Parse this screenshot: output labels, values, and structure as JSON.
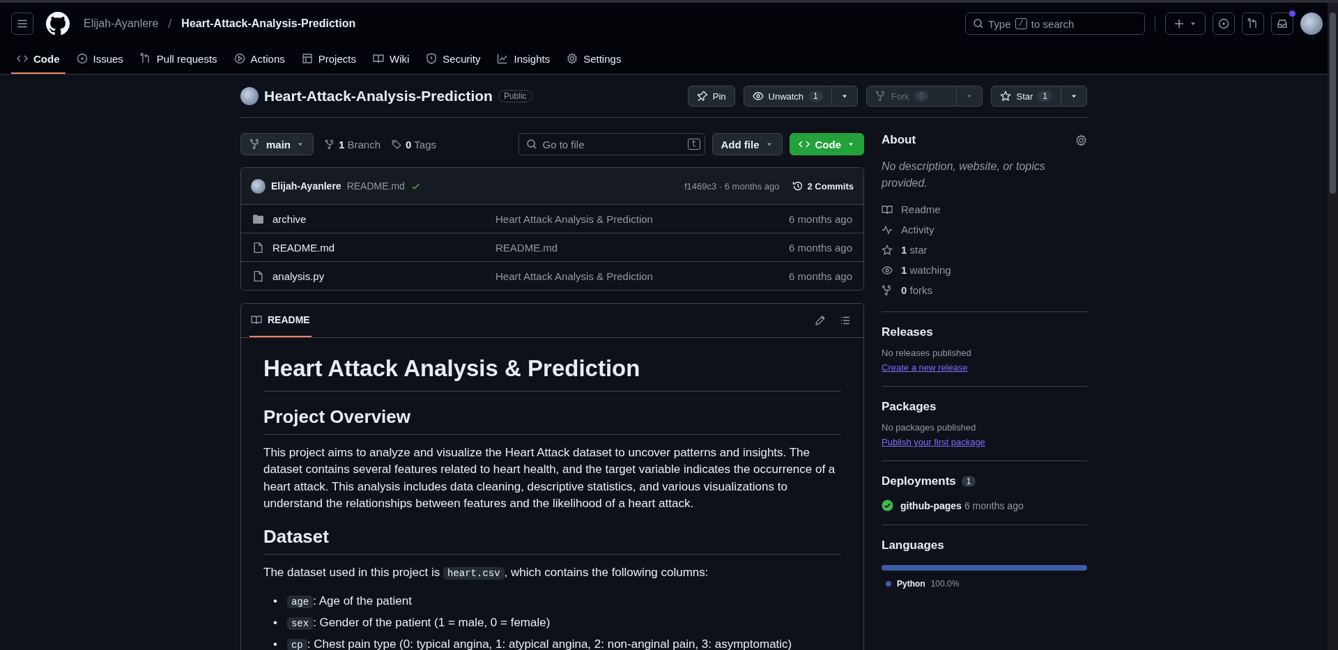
{
  "header": {
    "owner": "Elijah-Ayanlere",
    "separator": "/",
    "repo": "Heart-Attack-Analysis-Prediction",
    "search": {
      "before": "Type",
      "key": "/",
      "after": "to search"
    },
    "unread_notifications": true
  },
  "nav_tabs": [
    {
      "label": "Code",
      "selected": true
    },
    {
      "label": "Issues",
      "selected": false
    },
    {
      "label": "Pull requests",
      "selected": false
    },
    {
      "label": "Actions",
      "selected": false
    },
    {
      "label": "Projects",
      "selected": false
    },
    {
      "label": "Wiki",
      "selected": false
    },
    {
      "label": "Security",
      "selected": false
    },
    {
      "label": "Insights",
      "selected": false
    },
    {
      "label": "Settings",
      "selected": false
    }
  ],
  "repo": {
    "name": "Heart-Attack-Analysis-Prediction",
    "visibility": "Public",
    "actions": [
      {
        "label": "Pin",
        "disabled": false
      },
      {
        "label": "Unwatch",
        "count": "1",
        "disabled": false
      },
      {
        "label": "Fork",
        "count": "0",
        "disabled": true
      },
      {
        "label": "Star",
        "count": "1",
        "disabled": false
      }
    ]
  },
  "toolbar": {
    "branch": "main",
    "branches": "**1** Branch",
    "tags": "**0** Tags",
    "file_search": {
      "placeholder": "Go to file",
      "shortcut": "t"
    },
    "add_file": "Add file",
    "code_button": "Code"
  },
  "commit": {
    "author": "Elijah-Ayanlere",
    "message": "README.md",
    "passed": true,
    "hash_time": "f1469c3 · 6 months ago",
    "commits": "2 Commits"
  },
  "files": [
    {
      "kind": "folder",
      "name": "archive",
      "message": "Heart Attack Analysis & Prediction",
      "time": "6 months ago"
    },
    {
      "kind": "file",
      "name": "README.md",
      "message": "README.md",
      "time": "6 months ago"
    },
    {
      "kind": "file",
      "name": "analysis.py",
      "message": "Heart Attack Analysis & Prediction",
      "time": "6 months ago"
    }
  ],
  "readme": {
    "tab": "README",
    "blocks": [
      {
        "kind": "h1",
        "text": "Heart Attack Analysis & Prediction"
      },
      {
        "kind": "h2",
        "text": "Project Overview"
      },
      {
        "kind": "p",
        "parts": [
          {
            "text": "This project aims to analyze and visualize the Heart Attack dataset to uncover patterns and insights. The dataset contains several features related to heart health, and the target variable indicates the occurrence of a heart attack. This analysis includes data cleaning, descriptive statistics, and various visualizations to understand the relationships between features and the likelihood of a heart attack."
          }
        ]
      },
      {
        "kind": "h2",
        "text": "Dataset"
      },
      {
        "kind": "p",
        "parts": [
          {
            "text": "The dataset used in this project is "
          },
          {
            "code": "heart.csv"
          },
          {
            "text": ", which contains the following columns:"
          }
        ]
      },
      {
        "kind": "list",
        "marker": "•",
        "items": [
          {
            "code": "age",
            "text": ": Age of the patient"
          },
          {
            "code": "sex",
            "text": ": Gender of the patient (1 = male, 0 = female)"
          },
          {
            "code": "cp",
            "text": ": Chest pain type (0: typical angina, 1: atypical angina, 2: non-anginal pain, 3: asymptomatic)"
          }
        ]
      }
    ]
  },
  "sidebar": {
    "about": {
      "title": "About",
      "description": "No description, website, or topics provided.",
      "links": [
        "Readme",
        "Activity",
        "**1** star",
        "**1** watching",
        "**0** forks"
      ]
    },
    "releases": {
      "title": "Releases",
      "note": "No releases published",
      "link": "Create a new release"
    },
    "packages": {
      "title": "Packages",
      "note": "No packages published",
      "link": "Publish your first package"
    },
    "deployments": {
      "title": "Deployments",
      "count": "1",
      "items": [
        {
          "name": "github-pages",
          "time": "6 months ago",
          "passed": true
        }
      ]
    },
    "languages": {
      "title": "Languages",
      "items": [
        {
          "name": "Python",
          "percent": "100.0%",
          "color": "#3f5ba9",
          "level": 1
        }
      ]
    }
  }
}
